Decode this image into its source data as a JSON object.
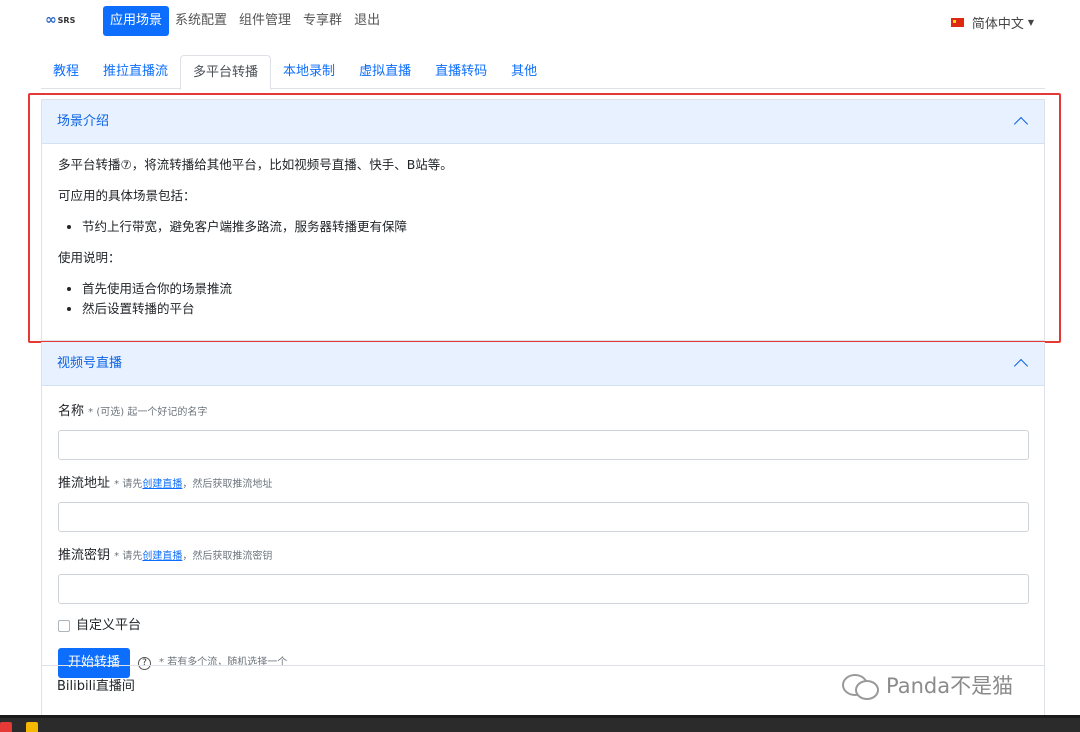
{
  "navbar": {
    "logo_text": "SRS",
    "menu": [
      "应用场景",
      "系统配置",
      "组件管理",
      "专享群",
      "退出"
    ],
    "active_menu": "应用场景",
    "language": "简体中文"
  },
  "tabs": [
    "教程",
    "推拉直播流",
    "多平台转播",
    "本地录制",
    "虚拟直播",
    "直播转码",
    "其他"
  ],
  "active_tab": "多平台转播",
  "intro": {
    "title": "场景介绍",
    "line1": "多平台转播⑦，将流转播给其他平台，比如视频号直播、快手、B站等。",
    "line2": "可应用的具体场景包括：",
    "bullets1": [
      "节约上行带宽，避免客户端推多路流，服务器转播更有保障"
    ],
    "line3": "使用说明：",
    "bullets2": [
      "首先使用适合你的场景推流",
      "然后设置转播的平台"
    ]
  },
  "section": {
    "title": "视频号直播",
    "name_label": "名称",
    "name_hint": "* (可选) 起一个好记的名字",
    "url_label": "推流地址",
    "url_hint_pre": "* 请先",
    "url_hint_link": "创建直播",
    "url_hint_post": "，然后获取推流地址",
    "key_label": "推流密钥",
    "key_hint_pre": "* 请先",
    "key_hint_link": "创建直播",
    "key_hint_post": "，然后获取推流密钥",
    "custom_platform": "自定义平台",
    "start_button": "开始转播",
    "help_glyph": "?",
    "button_note": "* 若有多个流，随机选择一个"
  },
  "next_section": "Bilibili直播间",
  "watermark": "Panda不是猫",
  "colors": {
    "primary": "#0d6efd",
    "accordion_header": "#e7f1ff",
    "annotation": "#e53935"
  }
}
